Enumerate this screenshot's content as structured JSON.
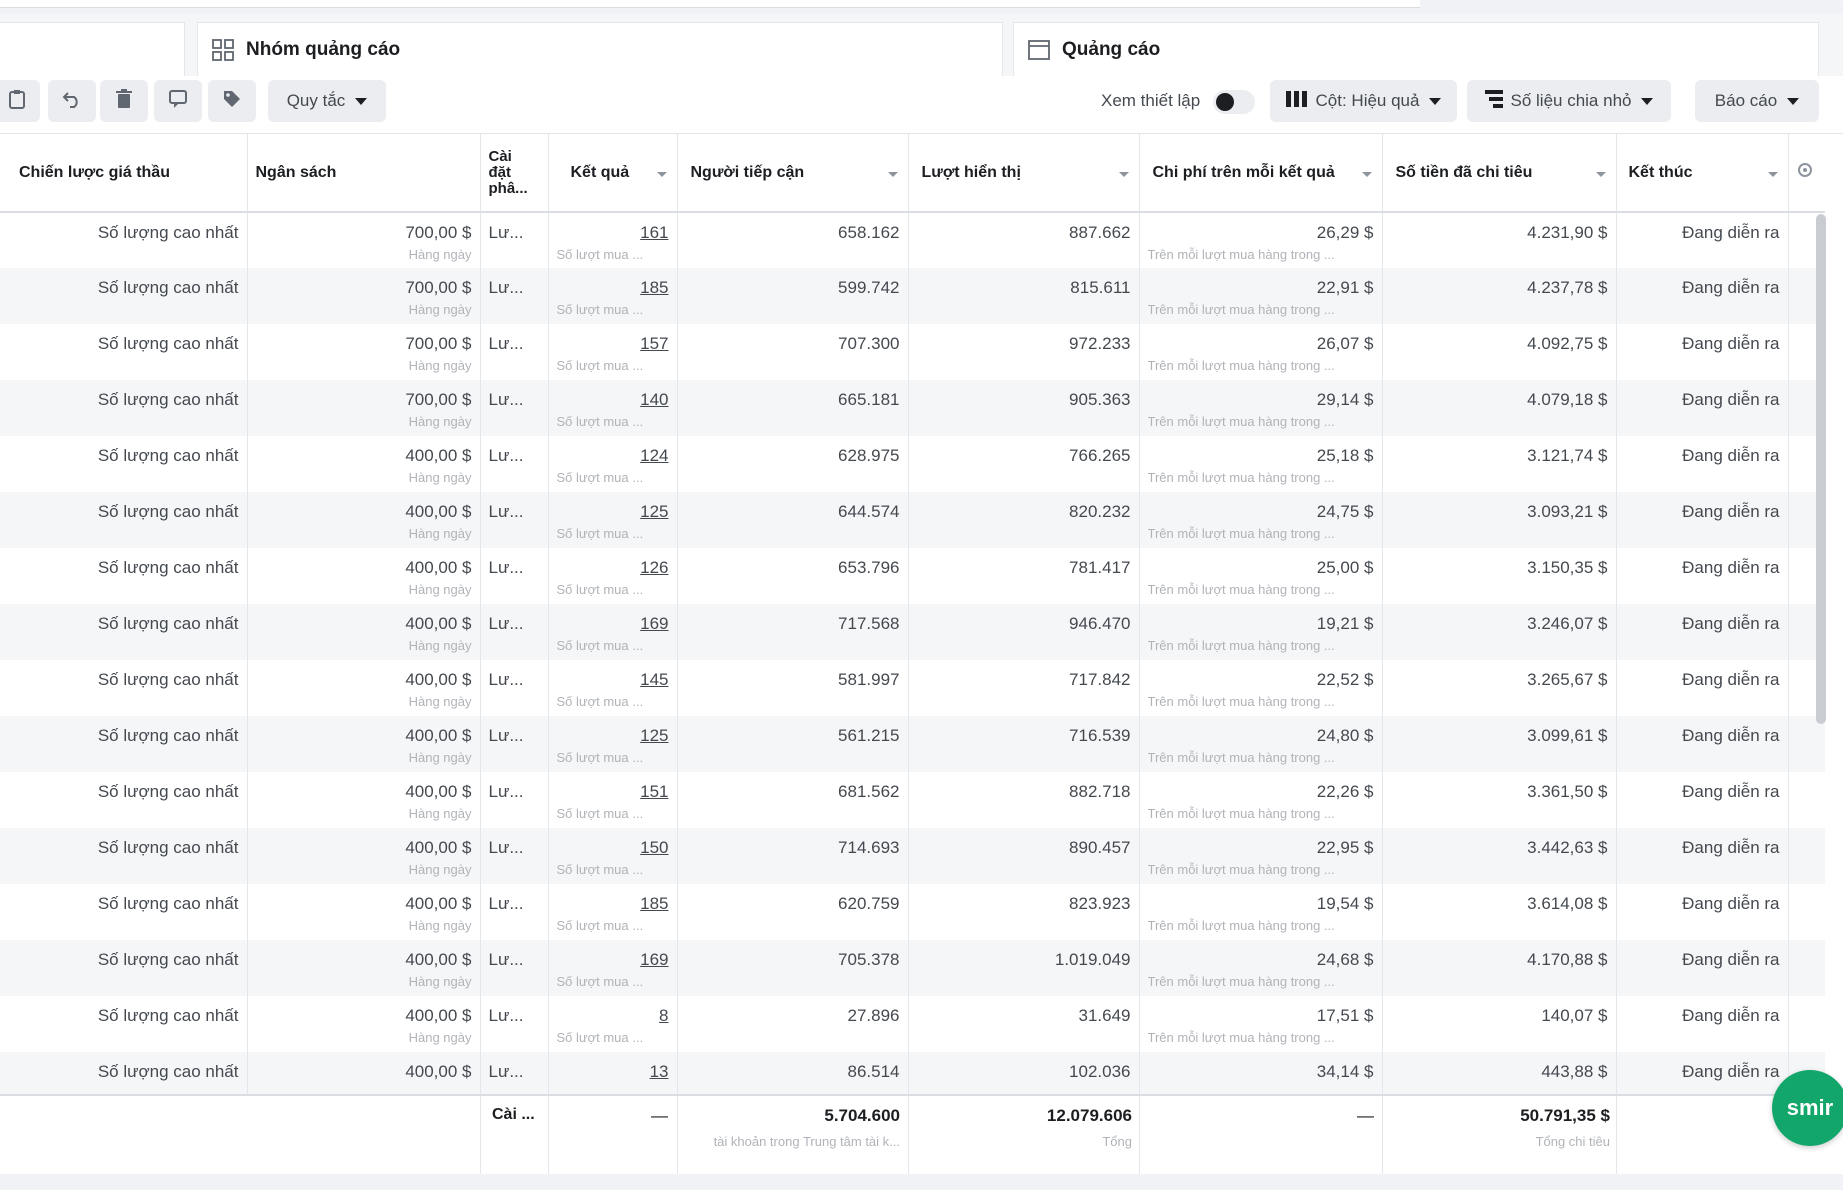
{
  "tabs": {
    "ad_sets": "Nhóm quảng cáo",
    "ads": "Quảng cáo"
  },
  "toolbar": {
    "rules": "Quy tắc",
    "view_setup": "Xem thiết lập",
    "columns": "Cột: Hiệu quả",
    "breakdown": "Số liệu chia nhỏ",
    "reports": "Báo cáo"
  },
  "columns": {
    "bid": "Chiến lược giá thầu",
    "budget": "Ngân sách",
    "attr": "Cài đặt phâ...",
    "results": "Kết quả",
    "reach": "Người tiếp cận",
    "impr": "Lượt hiển thị",
    "cpr": "Chi phí trên mỗi kết quả",
    "spent": "Số tiền đã chi tiêu",
    "end": "Kết thúc"
  },
  "rows": [
    {
      "bid": "Số lượng cao nhất",
      "budget": "700,00 $",
      "budget_sub": "Hàng ngày",
      "attr": "Lư...",
      "results": "161",
      "results_sub": "Số lượt mua ...",
      "reach": "658.162",
      "impr": "887.662",
      "cpr": "26,29 $",
      "cpr_sub": "Trên mỗi lượt mua hàng trong ...",
      "spent": "4.231,90 $",
      "end": "Đang diễn ra"
    },
    {
      "bid": "Số lượng cao nhất",
      "budget": "700,00 $",
      "budget_sub": "Hàng ngày",
      "attr": "Lư...",
      "results": "185",
      "results_sub": "Số lượt mua ...",
      "reach": "599.742",
      "impr": "815.611",
      "cpr": "22,91 $",
      "cpr_sub": "Trên mỗi lượt mua hàng trong ...",
      "spent": "4.237,78 $",
      "end": "Đang diễn ra"
    },
    {
      "bid": "Số lượng cao nhất",
      "budget": "700,00 $",
      "budget_sub": "Hàng ngày",
      "attr": "Lư...",
      "results": "157",
      "results_sub": "Số lượt mua ...",
      "reach": "707.300",
      "impr": "972.233",
      "cpr": "26,07 $",
      "cpr_sub": "Trên mỗi lượt mua hàng trong ...",
      "spent": "4.092,75 $",
      "end": "Đang diễn ra"
    },
    {
      "bid": "Số lượng cao nhất",
      "budget": "700,00 $",
      "budget_sub": "Hàng ngày",
      "attr": "Lư...",
      "results": "140",
      "results_sub": "Số lượt mua ...",
      "reach": "665.181",
      "impr": "905.363",
      "cpr": "29,14 $",
      "cpr_sub": "Trên mỗi lượt mua hàng trong ...",
      "spent": "4.079,18 $",
      "end": "Đang diễn ra"
    },
    {
      "bid": "Số lượng cao nhất",
      "budget": "400,00 $",
      "budget_sub": "Hàng ngày",
      "attr": "Lư...",
      "results": "124",
      "results_sub": "Số lượt mua ...",
      "reach": "628.975",
      "impr": "766.265",
      "cpr": "25,18 $",
      "cpr_sub": "Trên mỗi lượt mua hàng trong ...",
      "spent": "3.121,74 $",
      "end": "Đang diễn ra"
    },
    {
      "bid": "Số lượng cao nhất",
      "budget": "400,00 $",
      "budget_sub": "Hàng ngày",
      "attr": "Lư...",
      "results": "125",
      "results_sub": "Số lượt mua ...",
      "reach": "644.574",
      "impr": "820.232",
      "cpr": "24,75 $",
      "cpr_sub": "Trên mỗi lượt mua hàng trong ...",
      "spent": "3.093,21 $",
      "end": "Đang diễn ra"
    },
    {
      "bid": "Số lượng cao nhất",
      "budget": "400,00 $",
      "budget_sub": "Hàng ngày",
      "attr": "Lư...",
      "results": "126",
      "results_sub": "Số lượt mua ...",
      "reach": "653.796",
      "impr": "781.417",
      "cpr": "25,00 $",
      "cpr_sub": "Trên mỗi lượt mua hàng trong ...",
      "spent": "3.150,35 $",
      "end": "Đang diễn ra"
    },
    {
      "bid": "Số lượng cao nhất",
      "budget": "400,00 $",
      "budget_sub": "Hàng ngày",
      "attr": "Lư...",
      "results": "169",
      "results_sub": "Số lượt mua ...",
      "reach": "717.568",
      "impr": "946.470",
      "cpr": "19,21 $",
      "cpr_sub": "Trên mỗi lượt mua hàng trong ...",
      "spent": "3.246,07 $",
      "end": "Đang diễn ra"
    },
    {
      "bid": "Số lượng cao nhất",
      "budget": "400,00 $",
      "budget_sub": "Hàng ngày",
      "attr": "Lư...",
      "results": "145",
      "results_sub": "Số lượt mua ...",
      "reach": "581.997",
      "impr": "717.842",
      "cpr": "22,52 $",
      "cpr_sub": "Trên mỗi lượt mua hàng trong ...",
      "spent": "3.265,67 $",
      "end": "Đang diễn ra"
    },
    {
      "bid": "Số lượng cao nhất",
      "budget": "400,00 $",
      "budget_sub": "Hàng ngày",
      "attr": "Lư...",
      "results": "125",
      "results_sub": "Số lượt mua ...",
      "reach": "561.215",
      "impr": "716.539",
      "cpr": "24,80 $",
      "cpr_sub": "Trên mỗi lượt mua hàng trong ...",
      "spent": "3.099,61 $",
      "end": "Đang diễn ra"
    },
    {
      "bid": "Số lượng cao nhất",
      "budget": "400,00 $",
      "budget_sub": "Hàng ngày",
      "attr": "Lư...",
      "results": "151",
      "results_sub": "Số lượt mua ...",
      "reach": "681.562",
      "impr": "882.718",
      "cpr": "22,26 $",
      "cpr_sub": "Trên mỗi lượt mua hàng trong ...",
      "spent": "3.361,50 $",
      "end": "Đang diễn ra"
    },
    {
      "bid": "Số lượng cao nhất",
      "budget": "400,00 $",
      "budget_sub": "Hàng ngày",
      "attr": "Lư...",
      "results": "150",
      "results_sub": "Số lượt mua ...",
      "reach": "714.693",
      "impr": "890.457",
      "cpr": "22,95 $",
      "cpr_sub": "Trên mỗi lượt mua hàng trong ...",
      "spent": "3.442,63 $",
      "end": "Đang diễn ra"
    },
    {
      "bid": "Số lượng cao nhất",
      "budget": "400,00 $",
      "budget_sub": "Hàng ngày",
      "attr": "Lư...",
      "results": "185",
      "results_sub": "Số lượt mua ...",
      "reach": "620.759",
      "impr": "823.923",
      "cpr": "19,54 $",
      "cpr_sub": "Trên mỗi lượt mua hàng trong ...",
      "spent": "3.614,08 $",
      "end": "Đang diễn ra"
    },
    {
      "bid": "Số lượng cao nhất",
      "budget": "400,00 $",
      "budget_sub": "Hàng ngày",
      "attr": "Lư...",
      "results": "169",
      "results_sub": "Số lượt mua ...",
      "reach": "705.378",
      "impr": "1.019.049",
      "cpr": "24,68 $",
      "cpr_sub": "Trên mỗi lượt mua hàng trong ...",
      "spent": "4.170,88 $",
      "end": "Đang diễn ra"
    },
    {
      "bid": "Số lượng cao nhất",
      "budget": "400,00 $",
      "budget_sub": "Hàng ngày",
      "attr": "Lư...",
      "results": "8",
      "results_sub": "Số lượt mua ...",
      "reach": "27.896",
      "impr": "31.649",
      "cpr": "17,51 $",
      "cpr_sub": "Trên mỗi lượt mua hàng trong ...",
      "spent": "140,07 $",
      "end": "Đang diễn ra"
    },
    {
      "bid": "Số lượng cao nhất",
      "budget": "400,00 $",
      "budget_sub": "",
      "attr": "Lư...",
      "results": "13",
      "results_sub": "",
      "reach": "86.514",
      "impr": "102.036",
      "cpr": "34,14 $",
      "cpr_sub": "",
      "spent": "443,88 $",
      "end": "Đang diễn ra"
    }
  ],
  "footer": {
    "attr": "Cài ...",
    "results": "—",
    "reach": "5.704.600",
    "reach_sub": "tài khoản trong Trung tâm tài k...",
    "impr": "12.079.606",
    "impr_sub": "Tổng",
    "cpr": "—",
    "spent": "50.791,35 $",
    "spent_sub": "Tổng chi tiêu"
  },
  "badge": {
    "text": "smir"
  },
  "icons": [
    "clipboard-icon",
    "undo-icon",
    "trash-icon",
    "comment-icon",
    "tag-icon",
    "grid-icon",
    "ad-icon",
    "columns-icon",
    "breakdown-icon",
    "settings-icon"
  ]
}
